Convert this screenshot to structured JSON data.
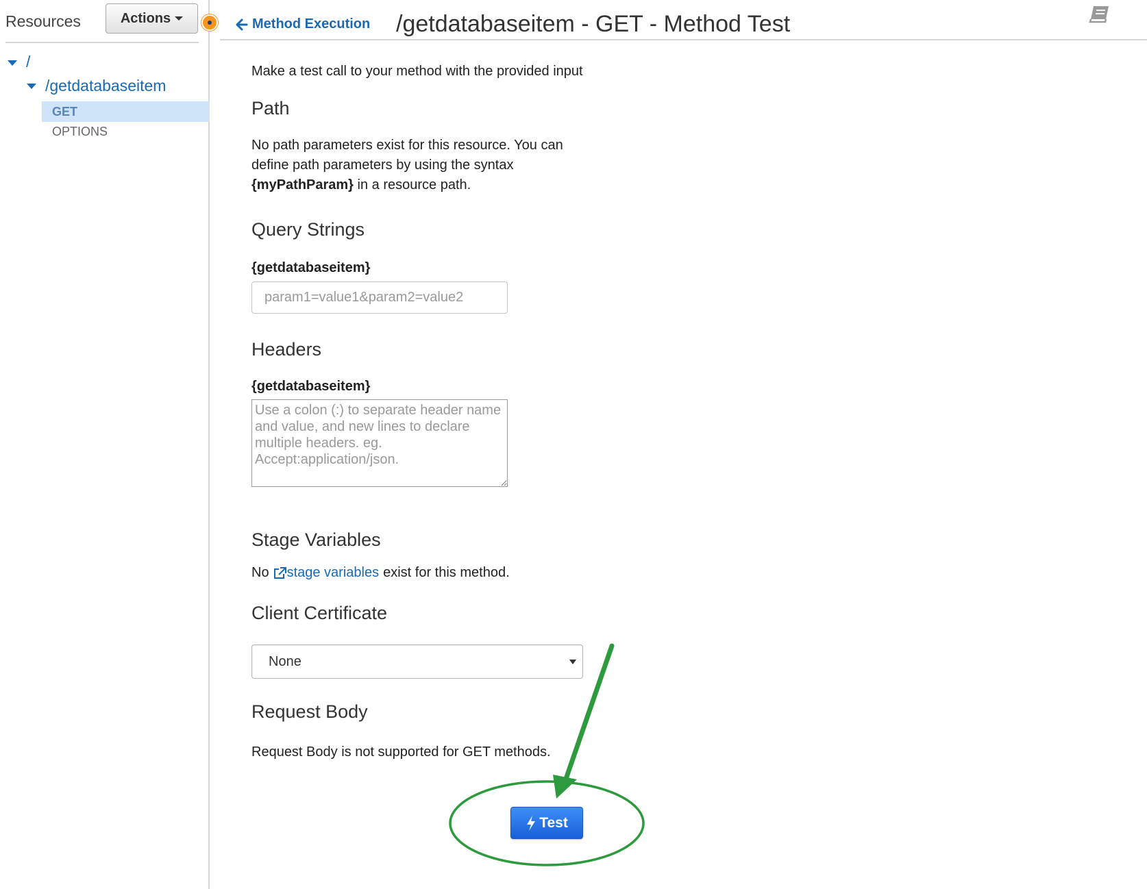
{
  "sidebar": {
    "title": "Resources",
    "actions_label": "Actions",
    "tree": {
      "root": "/",
      "resource": "/getdatabaseitem",
      "methods": [
        "GET",
        "OPTIONS"
      ]
    }
  },
  "header": {
    "back_label": "Method Execution",
    "title": "/getdatabaseitem - GET - Method Test"
  },
  "main": {
    "intro": "Make a test call to your method with the provided input",
    "path": {
      "heading": "Path",
      "line1": "No path parameters exist for this resource. You can",
      "line2": "define path parameters by using the syntax",
      "param_syntax": "{myPathParam}",
      "line3_rest": " in a resource path."
    },
    "query": {
      "heading": "Query Strings",
      "label": "{getdatabaseitem}",
      "placeholder": "param1=value1&param2=value2"
    },
    "headers": {
      "heading": "Headers",
      "label": "{getdatabaseitem}",
      "placeholder": "Use a colon (:) to separate header name and value, and new lines to declare multiple headers. eg. Accept:application/json."
    },
    "stage_variables": {
      "heading": "Stage Variables",
      "prefix": "No",
      "link": "stage variables",
      "suffix": "exist for this method."
    },
    "client_certificate": {
      "heading": "Client Certificate",
      "selected": "None"
    },
    "request_body": {
      "heading": "Request Body",
      "text": "Request Body is not supported for GET methods."
    },
    "test_button_label": "Test"
  },
  "colors": {
    "link": "#1a6ab3",
    "primary_button": "#1d6ae5",
    "annotation": "#2e9a3e",
    "selected_row": "#cfe4f8",
    "indicator": "#f7941d"
  },
  "icons": [
    "caret-down-icon",
    "tree-expand-icon",
    "arrow-left-icon",
    "book-icon",
    "external-link-icon",
    "lightning-bolt-icon"
  ]
}
